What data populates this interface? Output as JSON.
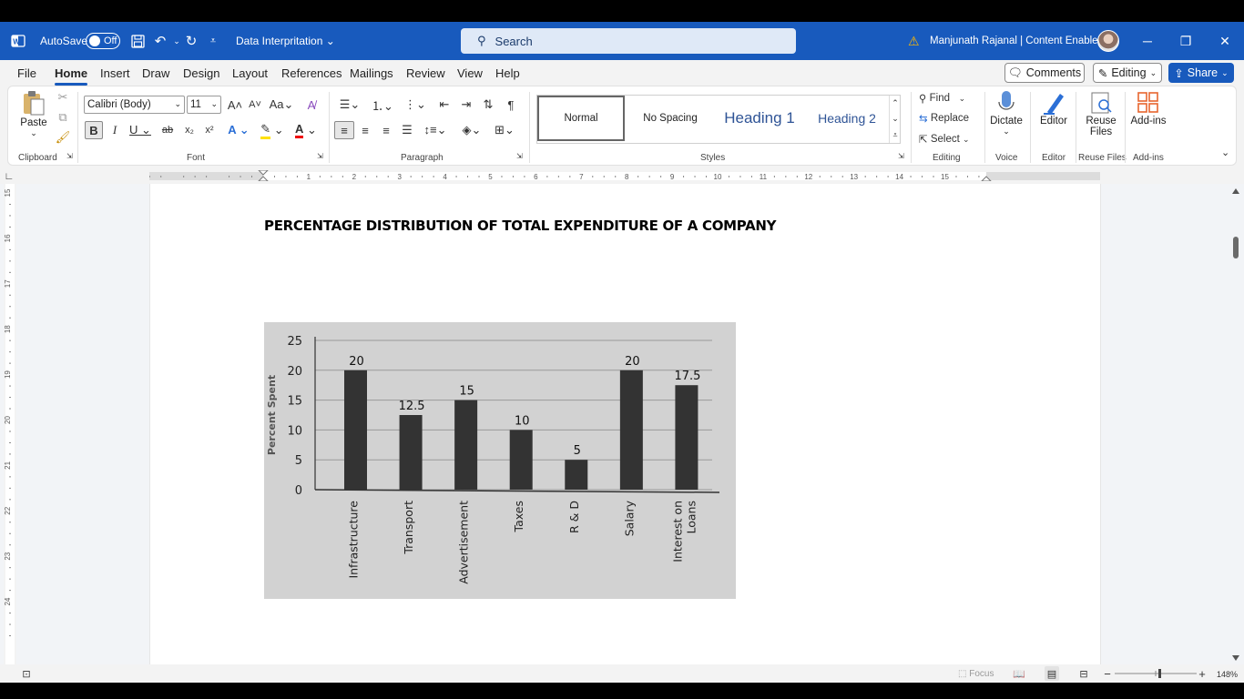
{
  "titlebar": {
    "autosave_label": "AutoSave",
    "autosave_state": "Off",
    "doc_title": "Data Interpritation",
    "search_placeholder": "Search",
    "user_name": "Manjunath Rajanal | Content Enablers"
  },
  "menu": {
    "tabs": [
      "File",
      "Home",
      "Insert",
      "Draw",
      "Design",
      "Layout",
      "References",
      "Mailings",
      "Review",
      "View",
      "Help"
    ],
    "active": "Home",
    "comments": "Comments",
    "editing": "Editing",
    "share": "Share"
  },
  "ribbon": {
    "clipboard": {
      "paste": "Paste",
      "label": "Clipboard"
    },
    "font": {
      "family": "Calibri (Body)",
      "size": "11",
      "label": "Font"
    },
    "paragraph": {
      "label": "Paragraph"
    },
    "styles": {
      "items": [
        "Normal",
        "No Spacing",
        "Heading 1",
        "Heading 2"
      ],
      "label": "Styles"
    },
    "editing": {
      "find": "Find",
      "replace": "Replace",
      "select": "Select",
      "label": "Editing"
    },
    "voice": {
      "dictate": "Dictate",
      "label": "Voice"
    },
    "editor": {
      "editor": "Editor",
      "label": "Editor"
    },
    "reuse": {
      "line1": "Reuse",
      "line2": "Files",
      "label": "Reuse Files"
    },
    "addins": {
      "addins": "Add-ins",
      "label": "Add-ins"
    }
  },
  "ruler": {
    "h_numbers": [
      "1",
      "2",
      "3",
      "4",
      "5",
      "6",
      "7",
      "8",
      "9",
      "10",
      "11",
      "12",
      "13",
      "14",
      "15"
    ],
    "v_numbers": [
      "15",
      "16",
      "17",
      "18",
      "19",
      "20",
      "21",
      "22",
      "23",
      "24"
    ]
  },
  "document": {
    "heading": "PERCENTAGE DISTRIBUTION OF TOTAL EXPENDITURE OF A COMPANY"
  },
  "chart_data": {
    "type": "bar",
    "title": "",
    "xlabel": "",
    "ylabel": "Percent Spent",
    "ylim": [
      0,
      25
    ],
    "yticks": [
      0,
      5,
      10,
      15,
      20,
      25
    ],
    "categories": [
      "Infrastructure",
      "Transport",
      "Advertisement",
      "Taxes",
      "R & D",
      "Salary",
      "Interest on Loans"
    ],
    "category_lines": [
      [
        "Infrastructure"
      ],
      [
        "Transport"
      ],
      [
        "Advertisement"
      ],
      [
        "Taxes"
      ],
      [
        "R & D"
      ],
      [
        "Salary"
      ],
      [
        "Interest on",
        "Loans"
      ]
    ],
    "values": [
      20,
      12.5,
      15,
      10,
      5,
      20,
      17.5
    ],
    "value_labels": [
      "20",
      "12.5",
      "15",
      "10",
      "5",
      "20",
      "17.5"
    ],
    "grid": true,
    "bar_color": "#333333"
  },
  "statusbar": {
    "focus": "Focus",
    "zoom": "148%"
  },
  "colors": {
    "title_blue": "#185abd",
    "accent": "#185abd"
  }
}
